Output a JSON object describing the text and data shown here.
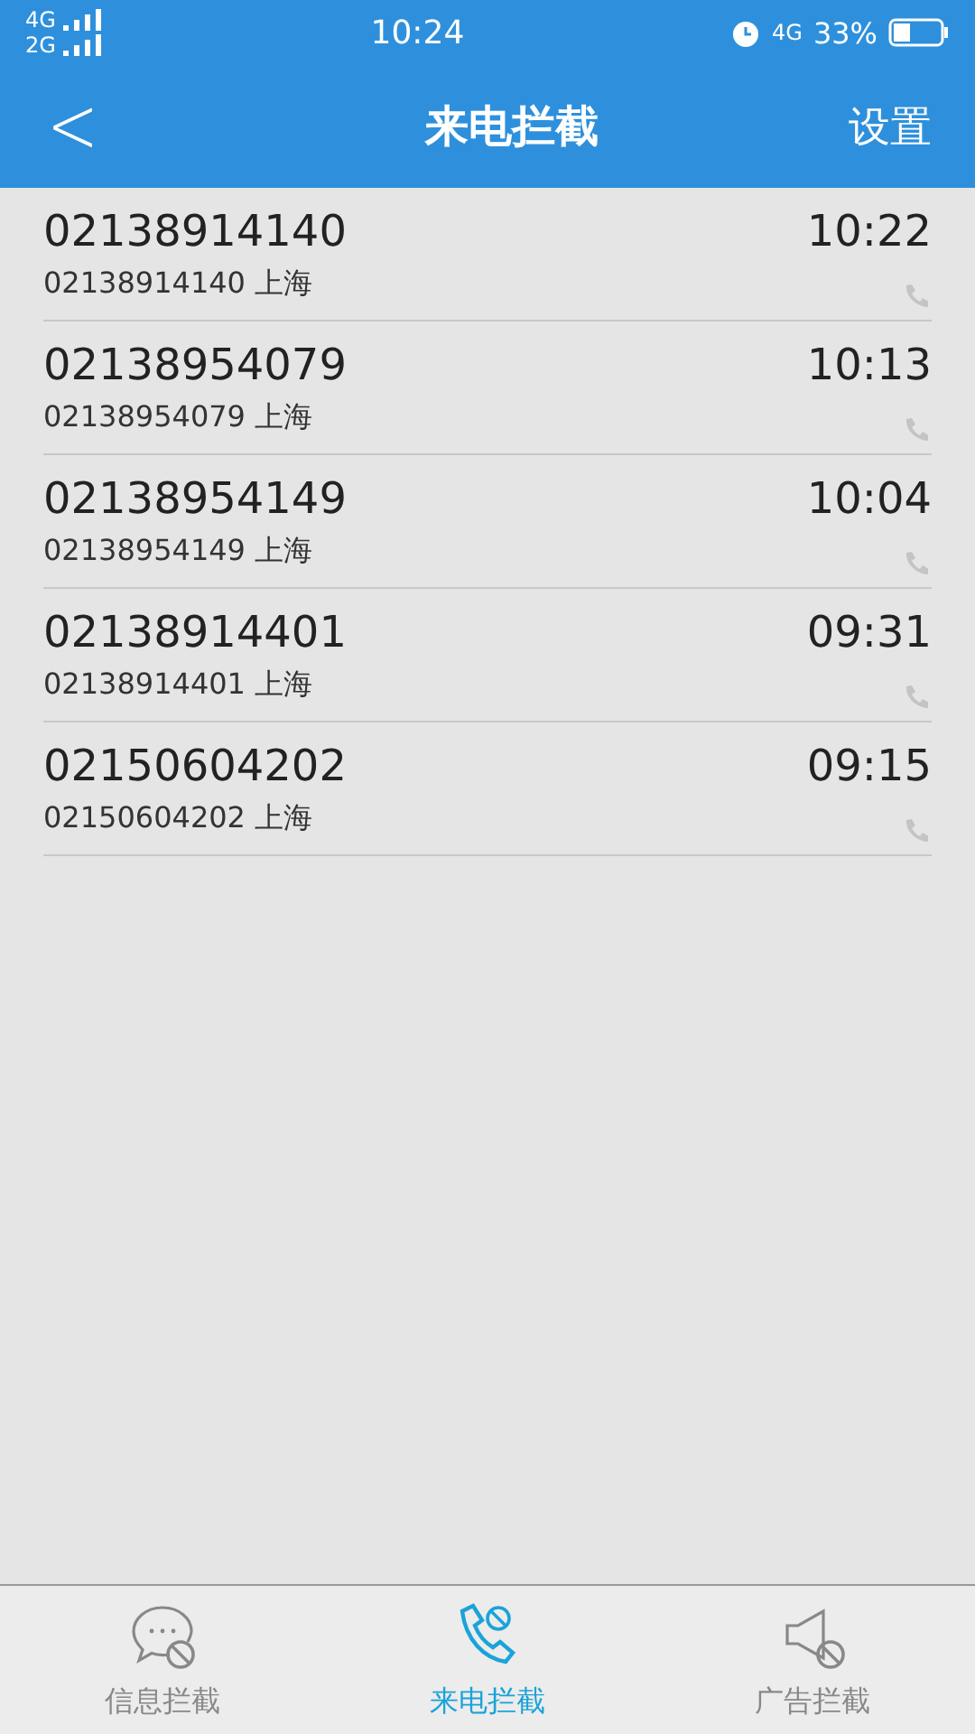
{
  "status_bar": {
    "sim1": "4G",
    "sim2": "2G",
    "time": "10:24",
    "network": "4G",
    "battery": "33%"
  },
  "header": {
    "back": "<",
    "title": "来电拦截",
    "action": "设置"
  },
  "calls": [
    {
      "number": "02138914140",
      "detail": "02138914140 上海",
      "time": "10:22"
    },
    {
      "number": "02138954079",
      "detail": "02138954079 上海",
      "time": "10:13"
    },
    {
      "number": "02138954149",
      "detail": "02138954149 上海",
      "time": "10:04"
    },
    {
      "number": "02138914401",
      "detail": "02138914401 上海",
      "time": "09:31"
    },
    {
      "number": "02150604202",
      "detail": "02150604202 上海",
      "time": "09:15"
    }
  ],
  "tabs": [
    {
      "kind": "message",
      "label": "信息拦截",
      "selected": false
    },
    {
      "kind": "call",
      "label": "来电拦截",
      "selected": true
    },
    {
      "kind": "ad",
      "label": "广告拦截",
      "selected": false
    }
  ]
}
